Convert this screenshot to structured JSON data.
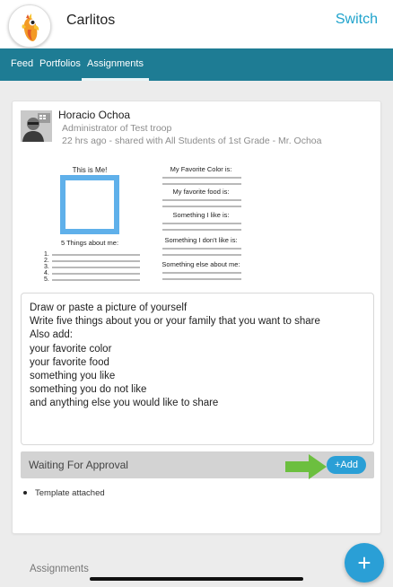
{
  "header": {
    "child_name": "Carlitos",
    "switch_label": "Switch"
  },
  "tabs": [
    {
      "label": "Feed",
      "active": false
    },
    {
      "label": "Portfolios",
      "active": false
    },
    {
      "label": "Assignments",
      "active": true
    }
  ],
  "post": {
    "author": "Horacio Ochoa",
    "role": "Administrator of Test troop",
    "meta": "22 hrs ago - shared with All Students of 1st Grade - Mr. Ochoa",
    "worksheet": {
      "left_title": "This is Me!",
      "things_title": "5 Things about me:",
      "numbers": [
        "1.",
        "2.",
        "3.",
        "4.",
        "5."
      ],
      "prompts": [
        "My Favorite Color is:",
        "My favorite food is:",
        "Something I like is:",
        "Something I don't like is:",
        "Something else about me:"
      ]
    },
    "instructions": "Draw or paste a picture of yourself\nWrite five things about you or your family that you want to share\nAlso add:\nyour favorite color\nyour favorite food\nsomething you like\nsomething you do not like\nand anything else you would like to share",
    "status_label": "Waiting For Approval",
    "add_label": "+Add",
    "attachment_label": "Template attached"
  },
  "section_title": "Assignments",
  "fab_label": "+",
  "colors": {
    "accent": "#2a9fd6",
    "tab_bar": "#1e7c94",
    "arrow": "#6cbf3f",
    "photo_frame": "#5fb0ea"
  },
  "icons": [
    "parrot-logo-icon",
    "user-photo-icon",
    "green-arrow-icon",
    "plus-icon"
  ]
}
